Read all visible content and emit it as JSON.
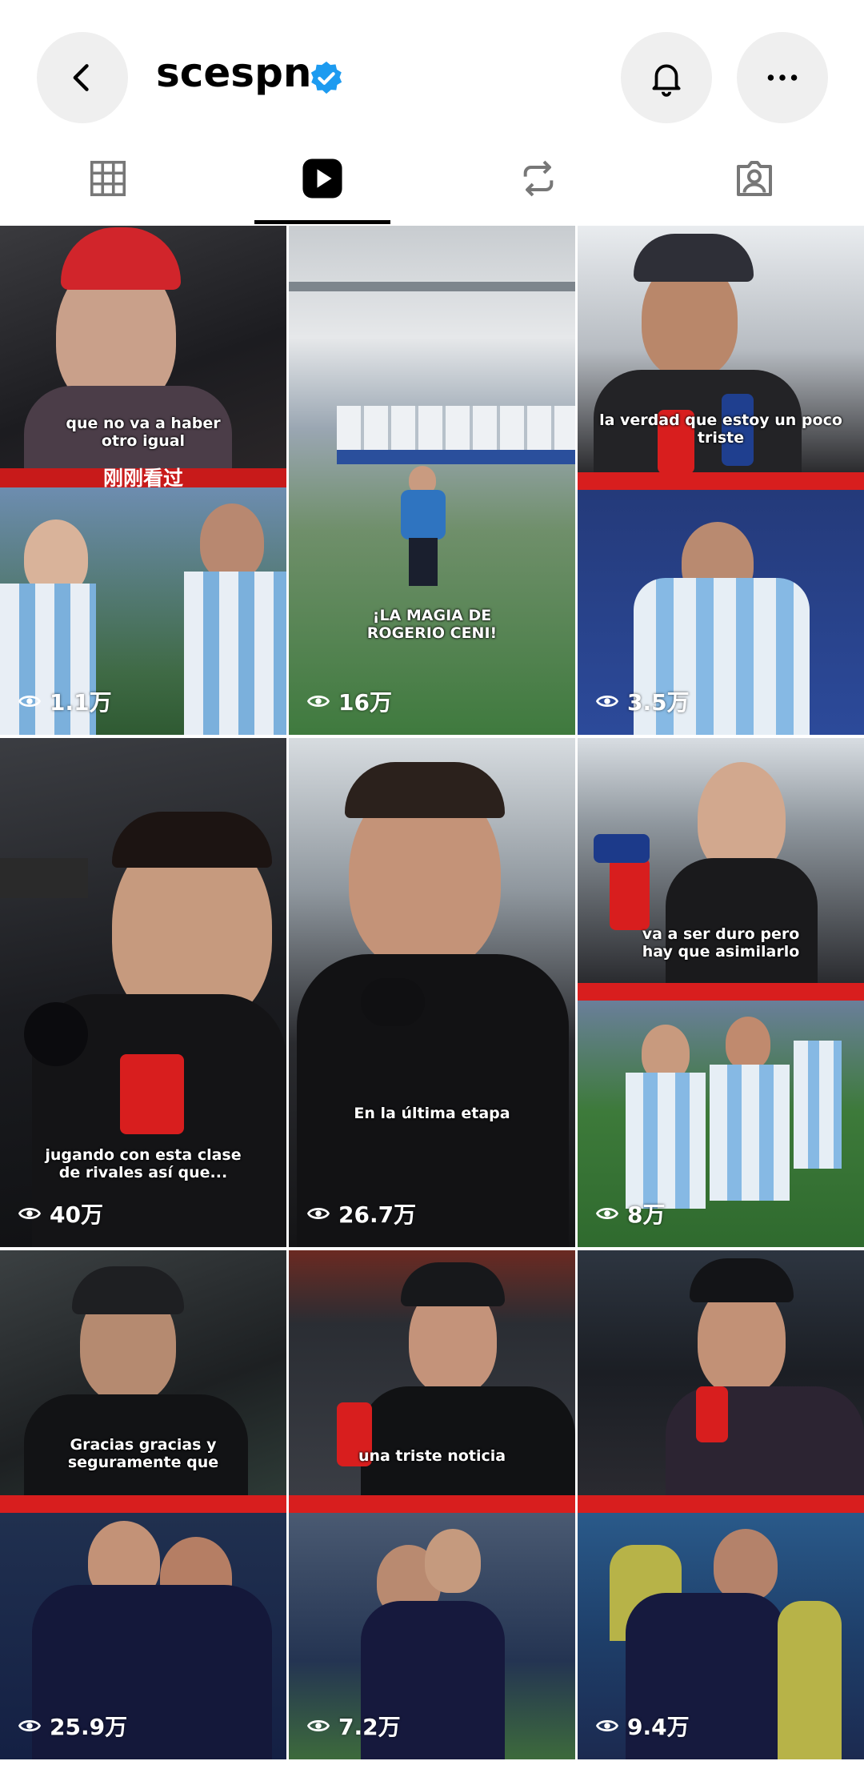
{
  "header": {
    "username": "scespn",
    "back_icon": "chevron-left-icon",
    "bell_icon": "bell-icon",
    "more_icon": "more-horizontal-icon"
  },
  "tabs": [
    {
      "name": "posts-grid",
      "icon": "grid-icon",
      "active": false
    },
    {
      "name": "reels",
      "icon": "reels-play-icon",
      "active": true
    },
    {
      "name": "reposts",
      "icon": "repost-icon",
      "active": false
    },
    {
      "name": "tagged",
      "icon": "tagged-person-icon",
      "active": false
    }
  ],
  "reels": [
    {
      "top_caption": "que no va a haber\notro igual",
      "recent_label": "刚刚看过",
      "views": "1.1万"
    },
    {
      "top_caption": "",
      "bottom_caption": "¡LA MAGIA DE\nROGERIO CENI!",
      "views": "16万"
    },
    {
      "top_caption": "la verdad que estoy un poco\ntriste",
      "views": "3.5万"
    },
    {
      "bottom_caption": "jugando con esta clase\nde rivales así que...",
      "views": "40万"
    },
    {
      "bottom_caption": "En la última etapa",
      "views": "26.7万"
    },
    {
      "top_caption": "va a ser duro pero\nhay que asimilarlo",
      "views": "8万"
    },
    {
      "top_caption": "Gracias gracias y\nseguramente que",
      "views": "25.9万"
    },
    {
      "top_caption": "una triste noticia",
      "views": "7.2万"
    },
    {
      "top_caption": "",
      "views": "9.4万"
    }
  ],
  "colors": {
    "accent_red": "#d81e1e",
    "verified_blue": "#1d9bf0",
    "button_bg": "#efefef"
  }
}
